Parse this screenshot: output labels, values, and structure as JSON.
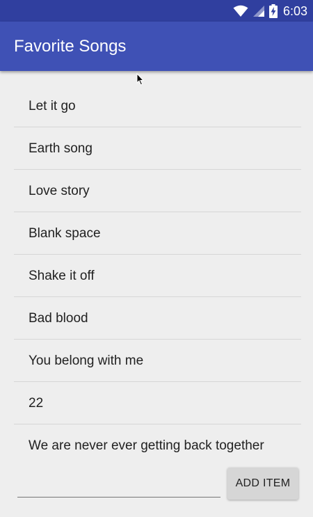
{
  "status_bar": {
    "time": "6:03",
    "icons": [
      "wifi-icon",
      "signal-icon",
      "battery-charging-icon"
    ]
  },
  "app_bar": {
    "title": "Favorite Songs"
  },
  "songs": [
    "Let it go",
    "Earth song",
    "Love story",
    "Blank space",
    "Shake it off",
    "Bad blood",
    "You belong with me",
    "22",
    "We are never ever getting back together"
  ],
  "input": {
    "value": "",
    "placeholder": ""
  },
  "add_button": {
    "label": "ADD ITEM"
  },
  "colors": {
    "status_bar": "#303f9f",
    "app_bar": "#3f51b5",
    "background": "#eeeeee",
    "button": "#d6d6d6"
  }
}
